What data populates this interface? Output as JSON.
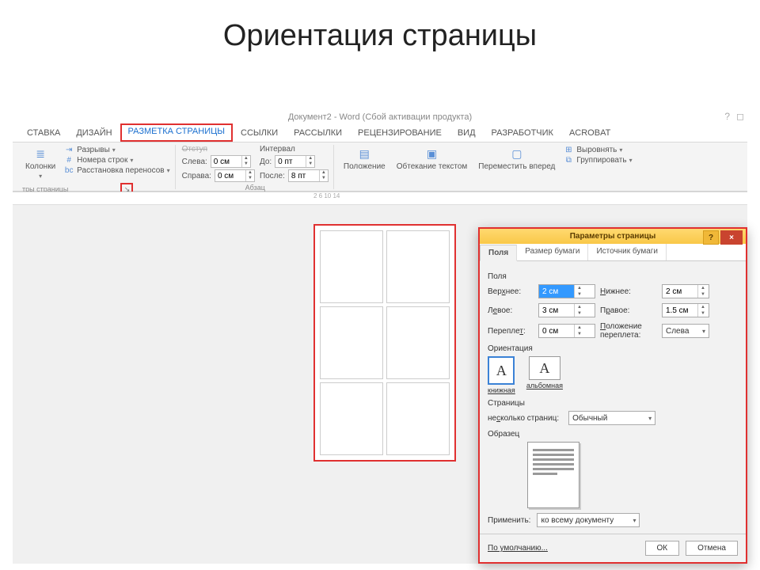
{
  "slide_title": "Ориентация страницы",
  "titlebar": "Документ2 - Word (Сбой активации продукта)",
  "tabs": {
    "t0": "СТАВКА",
    "t1": "ДИЗАЙН",
    "t2": "РАЗМЕТКА СТРАНИЦЫ",
    "t3": "ССЫЛКИ",
    "t4": "РАССЫЛКИ",
    "t5": "РЕЦЕНЗИРОВАНИЕ",
    "t6": "ВИД",
    "t7": "РАЗРАБОТЧИК",
    "t8": "ACROBAT"
  },
  "ribbon": {
    "columns_label": "Колонки",
    "breaks": "Разрывы",
    "linenum": "Номера строк",
    "hyphen": "Расстановка переносов",
    "group_page": "тры страницы",
    "indent_title": "Отступ",
    "spacing_title": "Интервал",
    "left": "Слева:",
    "right": "Справа:",
    "before": "До:",
    "after": "После:",
    "left_v": "0 см",
    "right_v": "0 см",
    "before_v": "0 пт",
    "after_v": "8 пт",
    "group_para": "Абзац",
    "position": "Положение",
    "wrap": "Обтекание текстом",
    "forward": "Переместить вперед",
    "align": "Выровнять",
    "group": "Группировать"
  },
  "ruler": "2  6  10  14",
  "dialog": {
    "title": "Параметры страницы",
    "tabs": {
      "t0": "Поля",
      "t1": "Размер бумаги",
      "t2": "Источник бумаги"
    },
    "sec_fields": "Поля",
    "top": "Верхнее:",
    "bottom": "Нижнее:",
    "left": "Левое:",
    "right": "Правое:",
    "gutter": "Переплет:",
    "gutter_pos": "Положение переплета:",
    "top_v": "2 см",
    "bottom_v": "2 см",
    "left_v": "3 см",
    "right_v": "1.5 см",
    "gutter_v": "0 см",
    "gutter_pos_v": "Слева",
    "sec_orient": "Ориентация",
    "portrait": "книжная",
    "landscape": "альбомная",
    "sec_pages": "Страницы",
    "multi": "несколько страниц:",
    "multi_v": "Обычный",
    "sec_preview": "Образец",
    "apply": "Применить:",
    "apply_v": "ко всему документу",
    "default": "По умолчанию...",
    "ok": "ОК",
    "cancel": "Отмена"
  }
}
